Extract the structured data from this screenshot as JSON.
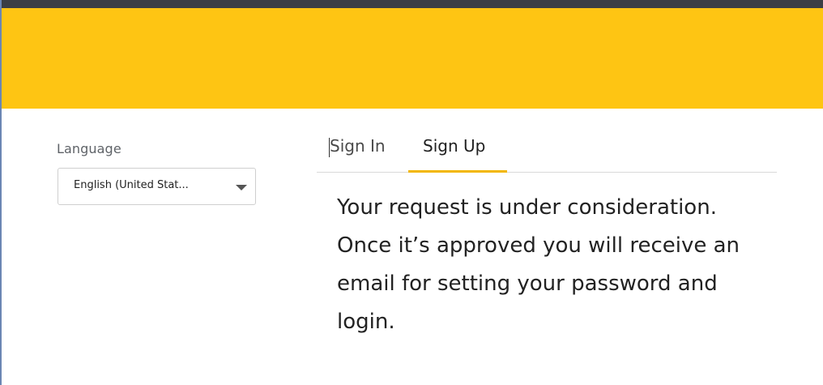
{
  "header": {
    "brand_color": "#FEC513",
    "topbar_color": "#3B3F45"
  },
  "language": {
    "label": "Language",
    "selected": "English (United Stat...",
    "caret_icon": "caret-down-icon"
  },
  "tabs": [
    {
      "label": "Sign In",
      "active": false
    },
    {
      "label": "Sign Up",
      "active": true
    }
  ],
  "message": {
    "text": "Your request is under consideration. Once it’s approved you will receive an email for setting your password and login."
  },
  "colors": {
    "accent": "#F2B705",
    "text": "#222222",
    "muted": "#5F6368"
  }
}
